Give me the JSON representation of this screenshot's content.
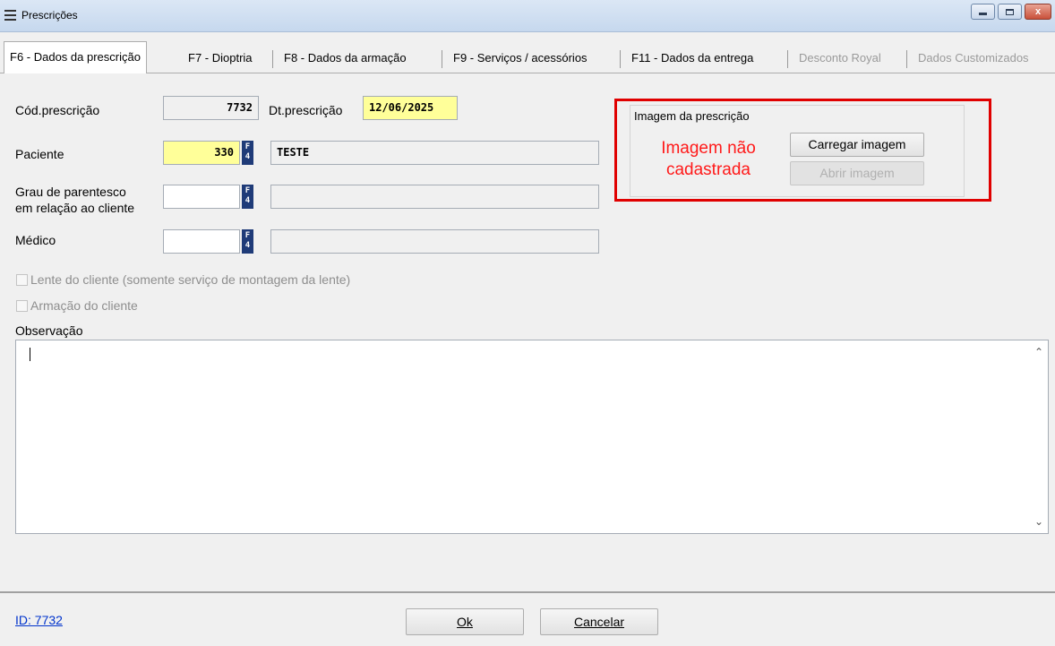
{
  "window": {
    "title": "Prescrições",
    "minimize_glyph": "",
    "close_glyph": "x"
  },
  "tabs": [
    {
      "label": "F6 - Dados da prescrição",
      "active": true,
      "enabled": true
    },
    {
      "label": "F7 - Dioptria",
      "active": false,
      "enabled": true
    },
    {
      "label": "F8 - Dados da armação",
      "active": false,
      "enabled": true
    },
    {
      "label": "F9 - Serviços / acessórios",
      "active": false,
      "enabled": true
    },
    {
      "label": "F11 - Dados da entrega",
      "active": false,
      "enabled": true
    },
    {
      "label": "Desconto Royal",
      "active": false,
      "enabled": false
    },
    {
      "label": "Dados Customizados",
      "active": false,
      "enabled": false
    }
  ],
  "form": {
    "cod_prescricao": {
      "label": "Cód.prescrição",
      "value": "7732"
    },
    "dt_prescricao": {
      "label": "Dt.prescrição",
      "value": "12/06/2025"
    },
    "paciente": {
      "label": "Paciente",
      "code": "330",
      "name": "TESTE"
    },
    "grau_parentesco": {
      "label_line1": "Grau de parentesco",
      "label_line2": "em relação ao cliente",
      "code": "",
      "name": ""
    },
    "medico": {
      "label": "Médico",
      "code": "",
      "name": ""
    },
    "f4_key": "F4",
    "lente_cliente": {
      "label": "Lente do cliente (somente serviço de montagem da lente)",
      "checked": false
    },
    "armacao_cliente": {
      "label": "Armação do cliente",
      "checked": false
    },
    "observacao": {
      "label": "Observação",
      "value": ""
    }
  },
  "imagem": {
    "group_title": "Imagem da prescrição",
    "status_line1": "Imagem não",
    "status_line2": "cadastrada",
    "load_button": "Carregar imagem",
    "open_button": "Abrir imagem"
  },
  "footer": {
    "id_link": "ID: 7732",
    "ok_button": "Ok",
    "cancel_button": "Cancelar"
  },
  "colors": {
    "required_field": "#ffff99",
    "highlight_border": "#e00000",
    "status_text": "#ff1a1a",
    "link": "#0033cc"
  }
}
